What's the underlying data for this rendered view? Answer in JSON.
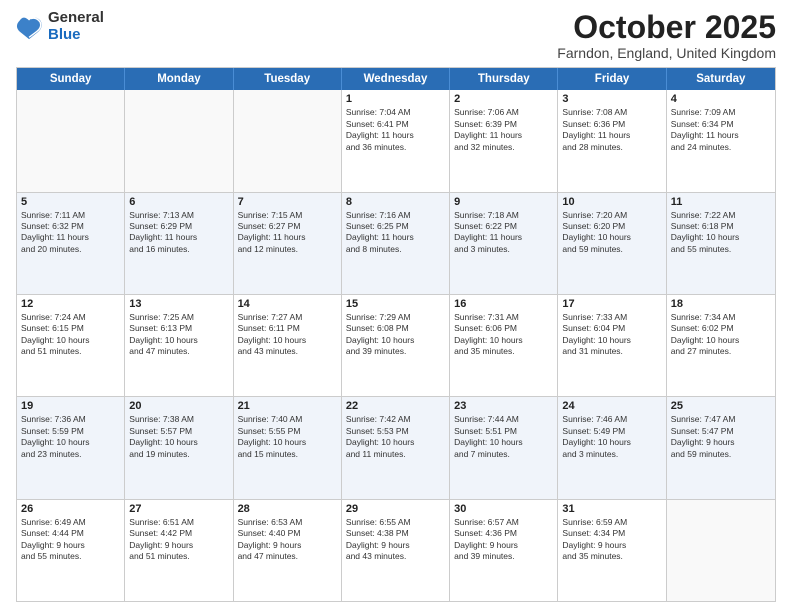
{
  "logo": {
    "general": "General",
    "blue": "Blue"
  },
  "title": "October 2025",
  "location": "Farndon, England, United Kingdom",
  "days_of_week": [
    "Sunday",
    "Monday",
    "Tuesday",
    "Wednesday",
    "Thursday",
    "Friday",
    "Saturday"
  ],
  "weeks": [
    [
      {
        "day": "",
        "info": ""
      },
      {
        "day": "",
        "info": ""
      },
      {
        "day": "",
        "info": ""
      },
      {
        "day": "1",
        "info": "Sunrise: 7:04 AM\nSunset: 6:41 PM\nDaylight: 11 hours\nand 36 minutes."
      },
      {
        "day": "2",
        "info": "Sunrise: 7:06 AM\nSunset: 6:39 PM\nDaylight: 11 hours\nand 32 minutes."
      },
      {
        "day": "3",
        "info": "Sunrise: 7:08 AM\nSunset: 6:36 PM\nDaylight: 11 hours\nand 28 minutes."
      },
      {
        "day": "4",
        "info": "Sunrise: 7:09 AM\nSunset: 6:34 PM\nDaylight: 11 hours\nand 24 minutes."
      }
    ],
    [
      {
        "day": "5",
        "info": "Sunrise: 7:11 AM\nSunset: 6:32 PM\nDaylight: 11 hours\nand 20 minutes."
      },
      {
        "day": "6",
        "info": "Sunrise: 7:13 AM\nSunset: 6:29 PM\nDaylight: 11 hours\nand 16 minutes."
      },
      {
        "day": "7",
        "info": "Sunrise: 7:15 AM\nSunset: 6:27 PM\nDaylight: 11 hours\nand 12 minutes."
      },
      {
        "day": "8",
        "info": "Sunrise: 7:16 AM\nSunset: 6:25 PM\nDaylight: 11 hours\nand 8 minutes."
      },
      {
        "day": "9",
        "info": "Sunrise: 7:18 AM\nSunset: 6:22 PM\nDaylight: 11 hours\nand 3 minutes."
      },
      {
        "day": "10",
        "info": "Sunrise: 7:20 AM\nSunset: 6:20 PM\nDaylight: 10 hours\nand 59 minutes."
      },
      {
        "day": "11",
        "info": "Sunrise: 7:22 AM\nSunset: 6:18 PM\nDaylight: 10 hours\nand 55 minutes."
      }
    ],
    [
      {
        "day": "12",
        "info": "Sunrise: 7:24 AM\nSunset: 6:15 PM\nDaylight: 10 hours\nand 51 minutes."
      },
      {
        "day": "13",
        "info": "Sunrise: 7:25 AM\nSunset: 6:13 PM\nDaylight: 10 hours\nand 47 minutes."
      },
      {
        "day": "14",
        "info": "Sunrise: 7:27 AM\nSunset: 6:11 PM\nDaylight: 10 hours\nand 43 minutes."
      },
      {
        "day": "15",
        "info": "Sunrise: 7:29 AM\nSunset: 6:08 PM\nDaylight: 10 hours\nand 39 minutes."
      },
      {
        "day": "16",
        "info": "Sunrise: 7:31 AM\nSunset: 6:06 PM\nDaylight: 10 hours\nand 35 minutes."
      },
      {
        "day": "17",
        "info": "Sunrise: 7:33 AM\nSunset: 6:04 PM\nDaylight: 10 hours\nand 31 minutes."
      },
      {
        "day": "18",
        "info": "Sunrise: 7:34 AM\nSunset: 6:02 PM\nDaylight: 10 hours\nand 27 minutes."
      }
    ],
    [
      {
        "day": "19",
        "info": "Sunrise: 7:36 AM\nSunset: 5:59 PM\nDaylight: 10 hours\nand 23 minutes."
      },
      {
        "day": "20",
        "info": "Sunrise: 7:38 AM\nSunset: 5:57 PM\nDaylight: 10 hours\nand 19 minutes."
      },
      {
        "day": "21",
        "info": "Sunrise: 7:40 AM\nSunset: 5:55 PM\nDaylight: 10 hours\nand 15 minutes."
      },
      {
        "day": "22",
        "info": "Sunrise: 7:42 AM\nSunset: 5:53 PM\nDaylight: 10 hours\nand 11 minutes."
      },
      {
        "day": "23",
        "info": "Sunrise: 7:44 AM\nSunset: 5:51 PM\nDaylight: 10 hours\nand 7 minutes."
      },
      {
        "day": "24",
        "info": "Sunrise: 7:46 AM\nSunset: 5:49 PM\nDaylight: 10 hours\nand 3 minutes."
      },
      {
        "day": "25",
        "info": "Sunrise: 7:47 AM\nSunset: 5:47 PM\nDaylight: 9 hours\nand 59 minutes."
      }
    ],
    [
      {
        "day": "26",
        "info": "Sunrise: 6:49 AM\nSunset: 4:44 PM\nDaylight: 9 hours\nand 55 minutes."
      },
      {
        "day": "27",
        "info": "Sunrise: 6:51 AM\nSunset: 4:42 PM\nDaylight: 9 hours\nand 51 minutes."
      },
      {
        "day": "28",
        "info": "Sunrise: 6:53 AM\nSunset: 4:40 PM\nDaylight: 9 hours\nand 47 minutes."
      },
      {
        "day": "29",
        "info": "Sunrise: 6:55 AM\nSunset: 4:38 PM\nDaylight: 9 hours\nand 43 minutes."
      },
      {
        "day": "30",
        "info": "Sunrise: 6:57 AM\nSunset: 4:36 PM\nDaylight: 9 hours\nand 39 minutes."
      },
      {
        "day": "31",
        "info": "Sunrise: 6:59 AM\nSunset: 4:34 PM\nDaylight: 9 hours\nand 35 minutes."
      },
      {
        "day": "",
        "info": ""
      }
    ]
  ]
}
